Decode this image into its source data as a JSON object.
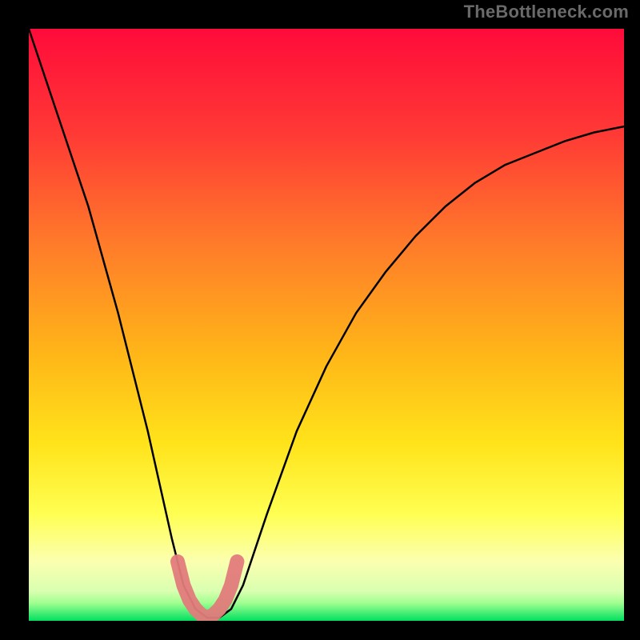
{
  "watermark": "TheBottleneck.com",
  "chart_data": {
    "type": "line",
    "title": "",
    "xlabel": "",
    "ylabel": "",
    "xlim": [
      0,
      100
    ],
    "ylim": [
      0,
      100
    ],
    "grid": false,
    "legend": false,
    "gradient": {
      "top": "#ff0b3a",
      "mid_upper": "#ff7a2a",
      "mid": "#ffe31a",
      "mid_lower": "#ffff7a",
      "near_bottom": "#f4ffa0",
      "bottom": "#00e060"
    },
    "series": [
      {
        "name": "curve",
        "stroke": "#000000",
        "x": [
          0,
          5,
          10,
          15,
          20,
          22,
          24,
          26,
          28,
          30,
          32,
          34,
          36,
          38,
          40,
          45,
          50,
          55,
          60,
          65,
          70,
          75,
          80,
          85,
          90,
          95,
          100
        ],
        "y": [
          100,
          85,
          70,
          52,
          32,
          23,
          14,
          6,
          2,
          0.5,
          0.5,
          2,
          6,
          12,
          18,
          32,
          43,
          52,
          59,
          65,
          70,
          74,
          77,
          79,
          81,
          82.5,
          83.5
        ]
      },
      {
        "name": "highlight",
        "stroke": "#e17b7b",
        "x": [
          25,
          26,
          27,
          28,
          29,
          30,
          31,
          32,
          33,
          34,
          35
        ],
        "y": [
          10,
          6,
          3.5,
          2,
          1,
          0.5,
          1,
          2,
          3.5,
          6,
          10
        ]
      }
    ]
  }
}
